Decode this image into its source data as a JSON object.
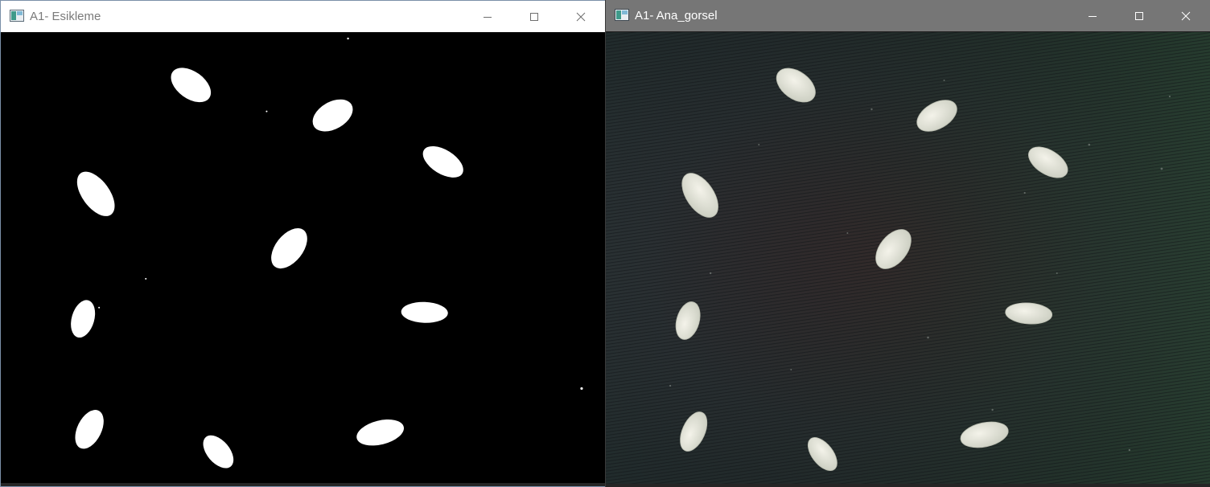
{
  "windows": [
    {
      "title": "A1- Esikleme",
      "icon": "opencv-window-icon",
      "controls": [
        "minimize-icon",
        "maximize-icon",
        "close-icon"
      ]
    },
    {
      "title": "A1- Ana_gorsel",
      "icon": "opencv-window-icon",
      "controls": [
        "minimize-icon",
        "maximize-icon",
        "close-icon"
      ]
    }
  ],
  "colors": {
    "active_titlebar": "#ffffff",
    "inactive_titlebar": "#767676",
    "threshold_background": "#000000",
    "grain_white": "#ffffff",
    "fabric_dark": "#2b3437"
  }
}
